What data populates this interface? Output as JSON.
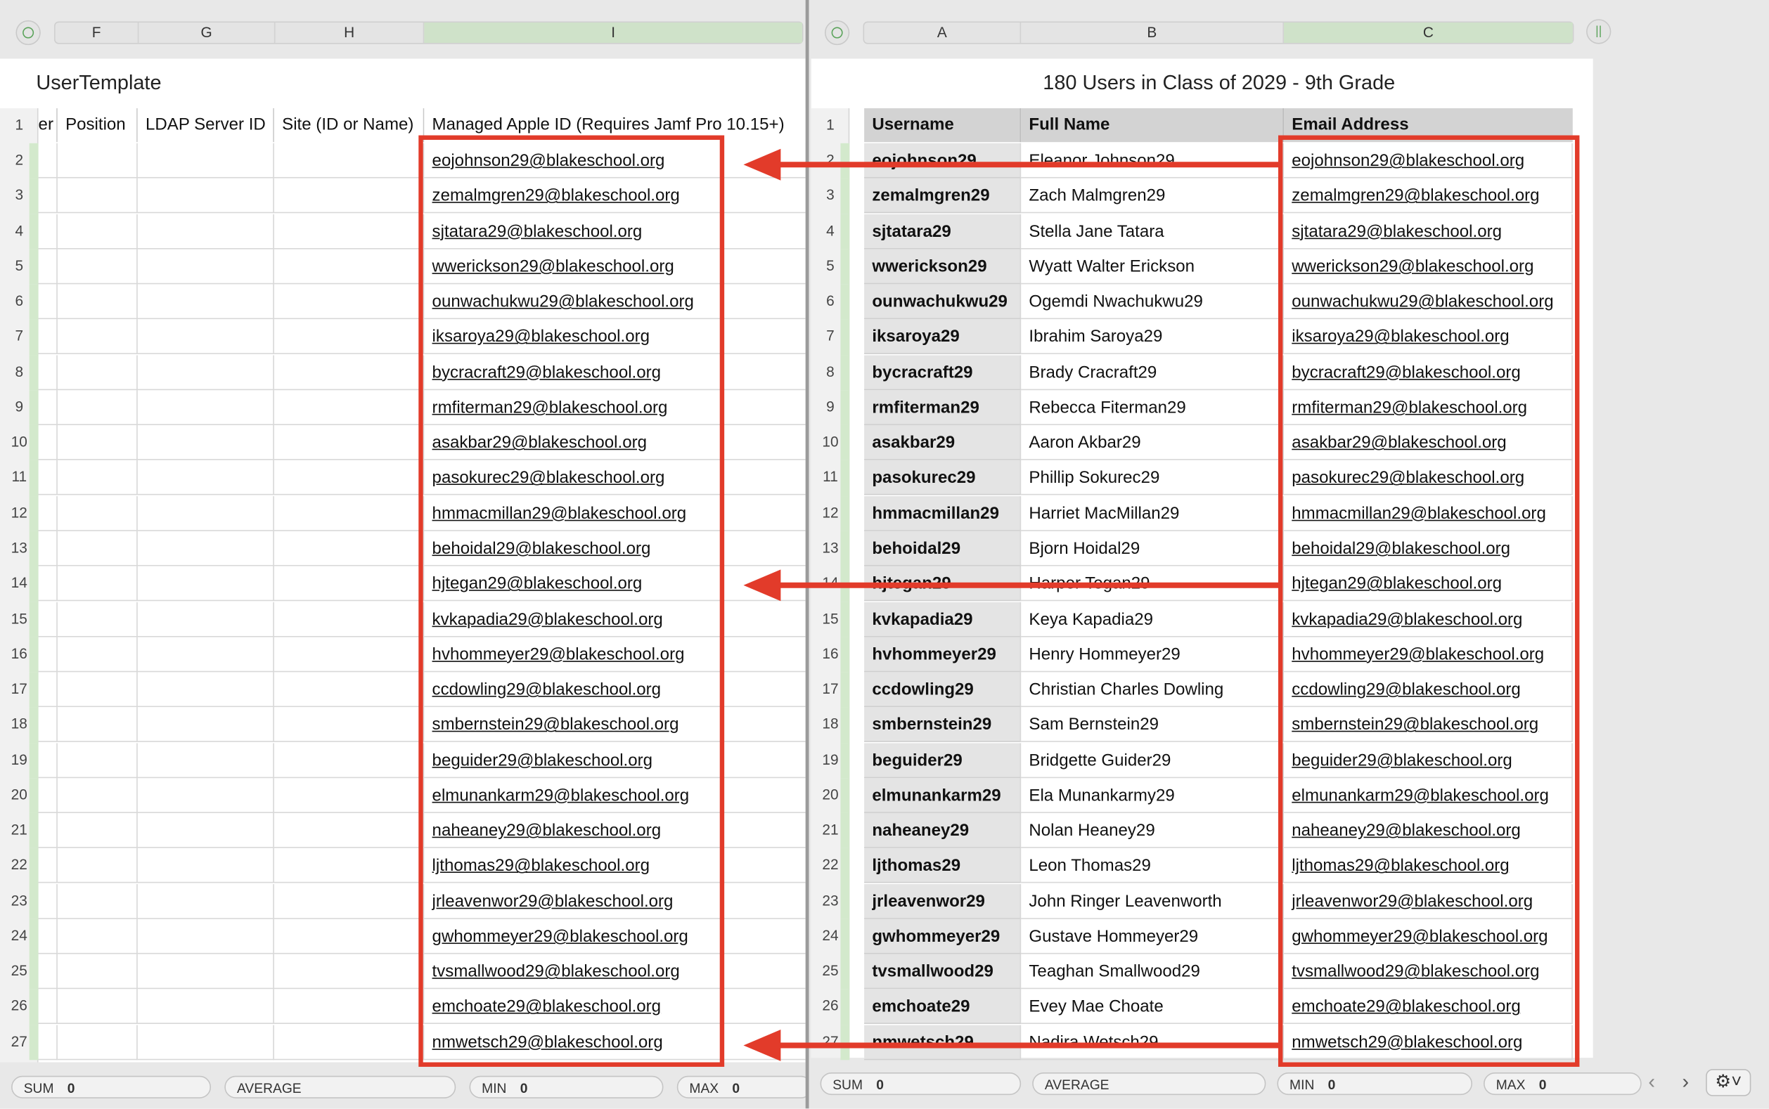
{
  "left": {
    "column_letters": [
      "F",
      "G",
      "H",
      "I"
    ],
    "title": "UserTemplate",
    "headers": [
      "er",
      "Position",
      "LDAP Server ID",
      "Site (ID or Name)",
      "Managed Apple ID (Requires Jamf Pro 10.15+)"
    ],
    "rows": [
      {
        "num": "2",
        "apple_id": "eojohnson29@blakeschool.org"
      },
      {
        "num": "3",
        "apple_id": "zemalmgren29@blakeschool.org"
      },
      {
        "num": "4",
        "apple_id": "sjtatara29@blakeschool.org"
      },
      {
        "num": "5",
        "apple_id": "wwerickson29@blakeschool.org"
      },
      {
        "num": "6",
        "apple_id": "ounwachukwu29@blakeschool.org"
      },
      {
        "num": "7",
        "apple_id": "iksaroya29@blakeschool.org"
      },
      {
        "num": "8",
        "apple_id": "bycracraft29@blakeschool.org"
      },
      {
        "num": "9",
        "apple_id": "rmfiterman29@blakeschool.org"
      },
      {
        "num": "10",
        "apple_id": "asakbar29@blakeschool.org"
      },
      {
        "num": "11",
        "apple_id": "pasokurec29@blakeschool.org"
      },
      {
        "num": "12",
        "apple_id": "hmmacmillan29@blakeschool.org"
      },
      {
        "num": "13",
        "apple_id": "behoidal29@blakeschool.org"
      },
      {
        "num": "14",
        "apple_id": "hjtegan29@blakeschool.org"
      },
      {
        "num": "15",
        "apple_id": "kvkapadia29@blakeschool.org"
      },
      {
        "num": "16",
        "apple_id": "hvhommeyer29@blakeschool.org"
      },
      {
        "num": "17",
        "apple_id": "ccdowling29@blakeschool.org"
      },
      {
        "num": "18",
        "apple_id": "smbernstein29@blakeschool.org"
      },
      {
        "num": "19",
        "apple_id": "beguider29@blakeschool.org"
      },
      {
        "num": "20",
        "apple_id": "elmunankarm29@blakeschool.org"
      },
      {
        "num": "21",
        "apple_id": "naheaney29@blakeschool.org"
      },
      {
        "num": "22",
        "apple_id": "ljthomas29@blakeschool.org"
      },
      {
        "num": "23",
        "apple_id": "jrleavenwor29@blakeschool.org"
      },
      {
        "num": "24",
        "apple_id": "gwhommeyer29@blakeschool.org"
      },
      {
        "num": "25",
        "apple_id": "tvsmallwood29@blakeschool.org"
      },
      {
        "num": "26",
        "apple_id": "emchoate29@blakeschool.org"
      },
      {
        "num": "27",
        "apple_id": "nmwetsch29@blakeschool.org"
      }
    ],
    "stats": {
      "sum_label": "SUM",
      "sum_value": "0",
      "average_label": "AVERAGE",
      "min_label": "MIN",
      "min_value": "0",
      "max_label": "MAX",
      "max_value": "0"
    }
  },
  "right": {
    "column_letters": [
      "A",
      "B",
      "C"
    ],
    "title": "180 Users in Class of 2029 - 9th Grade",
    "headers": [
      "Username",
      "Full Name",
      "Email Address"
    ],
    "rows": [
      {
        "num": "2",
        "username": "eojohnson29",
        "full_name": "Eleanor Johnson29",
        "email": "eojohnson29@blakeschool.org"
      },
      {
        "num": "3",
        "username": "zemalmgren29",
        "full_name": "Zach Malmgren29",
        "email": "zemalmgren29@blakeschool.org"
      },
      {
        "num": "4",
        "username": "sjtatara29",
        "full_name": "Stella Jane Tatara",
        "email": "sjtatara29@blakeschool.org"
      },
      {
        "num": "5",
        "username": "wwerickson29",
        "full_name": "Wyatt Walter Erickson",
        "email": "wwerickson29@blakeschool.org"
      },
      {
        "num": "6",
        "username": "ounwachukwu29",
        "full_name": "Ogemdi Nwachukwu29",
        "email": "ounwachukwu29@blakeschool.org"
      },
      {
        "num": "7",
        "username": "iksaroya29",
        "full_name": "Ibrahim Saroya29",
        "email": "iksaroya29@blakeschool.org"
      },
      {
        "num": "8",
        "username": "bycracraft29",
        "full_name": "Brady Cracraft29",
        "email": "bycracraft29@blakeschool.org"
      },
      {
        "num": "9",
        "username": "rmfiterman29",
        "full_name": "Rebecca Fiterman29",
        "email": "rmfiterman29@blakeschool.org"
      },
      {
        "num": "10",
        "username": "asakbar29",
        "full_name": "Aaron Akbar29",
        "email": "asakbar29@blakeschool.org"
      },
      {
        "num": "11",
        "username": "pasokurec29",
        "full_name": "Phillip Sokurec29",
        "email": "pasokurec29@blakeschool.org"
      },
      {
        "num": "12",
        "username": "hmmacmillan29",
        "full_name": "Harriet MacMillan29",
        "email": "hmmacmillan29@blakeschool.org"
      },
      {
        "num": "13",
        "username": "behoidal29",
        "full_name": "Bjorn Hoidal29",
        "email": "behoidal29@blakeschool.org"
      },
      {
        "num": "14",
        "username": "hjtegan29",
        "full_name": "Harper Tegan29",
        "email": "hjtegan29@blakeschool.org"
      },
      {
        "num": "15",
        "username": "kvkapadia29",
        "full_name": "Keya Kapadia29",
        "email": "kvkapadia29@blakeschool.org"
      },
      {
        "num": "16",
        "username": "hvhommeyer29",
        "full_name": "Henry Hommeyer29",
        "email": "hvhommeyer29@blakeschool.org"
      },
      {
        "num": "17",
        "username": "ccdowling29",
        "full_name": "Christian Charles Dowling",
        "email": "ccdowling29@blakeschool.org"
      },
      {
        "num": "18",
        "username": "smbernstein29",
        "full_name": "Sam Bernstein29",
        "email": "smbernstein29@blakeschool.org"
      },
      {
        "num": "19",
        "username": "beguider29",
        "full_name": "Bridgette Guider29",
        "email": "beguider29@blakeschool.org"
      },
      {
        "num": "20",
        "username": "elmunankarm29",
        "full_name": "Ela Munankarmy29",
        "email": "elmunankarm29@blakeschool.org"
      },
      {
        "num": "21",
        "username": "naheaney29",
        "full_name": "Nolan Heaney29",
        "email": "naheaney29@blakeschool.org"
      },
      {
        "num": "22",
        "username": "ljthomas29",
        "full_name": "Leon Thomas29",
        "email": "ljthomas29@blakeschool.org"
      },
      {
        "num": "23",
        "username": "jrleavenwor29",
        "full_name": "John Ringer Leavenworth",
        "email": "jrleavenwor29@blakeschool.org"
      },
      {
        "num": "24",
        "username": "gwhommeyer29",
        "full_name": "Gustave Hommeyer29",
        "email": "gwhommeyer29@blakeschool.org"
      },
      {
        "num": "25",
        "username": "tvsmallwood29",
        "full_name": "Teaghan Smallwood29",
        "email": "tvsmallwood29@blakeschool.org"
      },
      {
        "num": "26",
        "username": "emchoate29",
        "full_name": "Evey Mae Choate",
        "email": "emchoate29@blakeschool.org"
      },
      {
        "num": "27",
        "username": "nmwetsch29",
        "full_name": "Nadira Wetsch29",
        "email": "nmwetsch29@blakeschool.org"
      }
    ],
    "stats": {
      "sum_label": "SUM",
      "sum_value": "0",
      "average_label": "AVERAGE",
      "min_label": "MIN",
      "min_value": "0",
      "max_label": "MAX",
      "max_value": "0"
    }
  },
  "row1_label": "1",
  "annotation_color": "#e23b2a",
  "icons": {
    "prev": "chevron-left-icon",
    "next": "chevron-right-icon",
    "gear": "gear-icon"
  }
}
